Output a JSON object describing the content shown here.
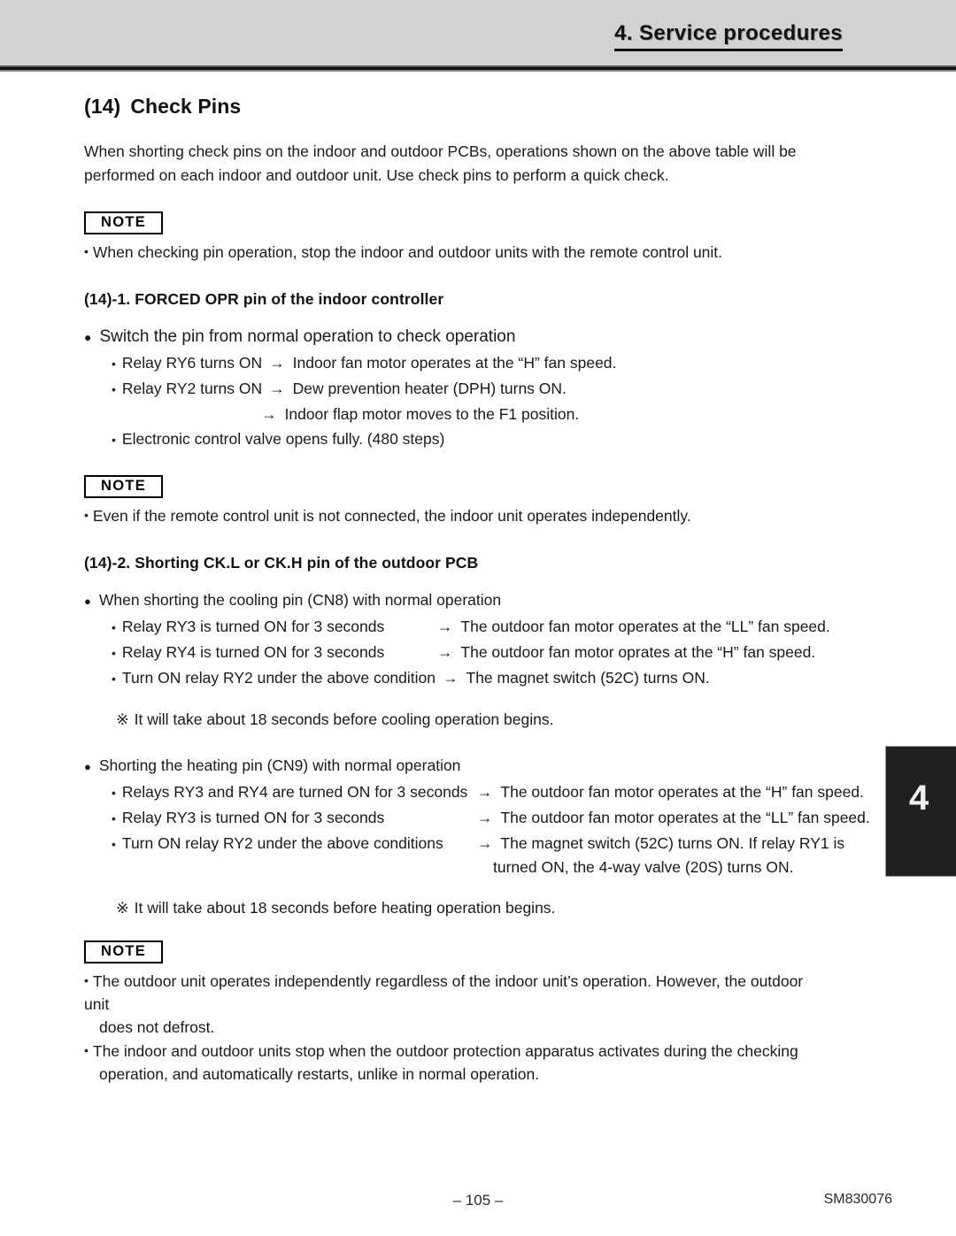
{
  "header": {
    "chapter_title": "4. Service procedures"
  },
  "chapter_tab": {
    "number": "4"
  },
  "section": {
    "number": "(14)",
    "title": "Check Pins",
    "intro": "When shorting check pins on the indoor and outdoor PCBs, operations shown on the above table will be performed on each indoor and outdoor unit. Use check pins to perform a quick check."
  },
  "note1": {
    "badge": "NOTE",
    "bullet": "•",
    "line1": "When checking pin operation, stop the indoor and outdoor units with the remote control unit."
  },
  "subsection1": {
    "heading": "(14)-1. FORCED OPR pin of the indoor controller",
    "group": {
      "disc": "●",
      "head": "Switch the pin from normal operation to check operation",
      "items": [
        {
          "dot": "•",
          "lead": "Relay RY6 turns ON",
          "arrow": "→",
          "tail": "Indoor fan motor operates at the “H” fan speed."
        },
        {
          "dot": "•",
          "lead": "Relay RY2 turns ON",
          "arrow": "→",
          "tail": "Dew prevention heater (DPH) turns ON."
        },
        {
          "dot": "",
          "lead": "",
          "arrow": "→",
          "tail": "Indoor flap motor moves to the F1 position."
        },
        {
          "dot": "•",
          "lead": "Electronic control valve opens fully. (480 steps)",
          "arrow": "",
          "tail": ""
        }
      ]
    }
  },
  "note2": {
    "badge": "NOTE",
    "bullet": "•",
    "line1": "Even if the remote control unit is not connected, the indoor unit operates independently."
  },
  "subsection2": {
    "heading": "(14)-2. Shorting CK.L or CK.H pin of the outdoor PCB",
    "cooling": {
      "disc": "●",
      "head": "When shorting the cooling pin (CN8) with normal operation",
      "items": [
        {
          "dot": "•",
          "lead": "Relay RY3 is turned ON for 3 seconds",
          "arrow": "→",
          "tail": "The outdoor fan motor operates at the “LL” fan speed."
        },
        {
          "dot": "•",
          "lead": "Relay RY4 is turned ON for 3 seconds",
          "arrow": "→",
          "tail": "The outdoor fan motor oprates at the “H” fan speed."
        },
        {
          "dot": "•",
          "lead": "Turn ON relay RY2 under the above condition",
          "arrow": "→",
          "tail": "The magnet switch (52C) turns ON."
        }
      ],
      "star": "※",
      "star_text": "It will take about 18 seconds before cooling operation begins."
    },
    "heating": {
      "disc": "●",
      "head": "Shorting the heating pin (CN9) with normal operation",
      "items": [
        {
          "dot": "•",
          "lead": "Relays RY3 and RY4 are turned ON for 3 seconds",
          "arrow": "→",
          "tail": "The outdoor fan motor operates at the “H” fan speed."
        },
        {
          "dot": "•",
          "lead": "Relay RY3 is turned ON for 3 seconds",
          "arrow": "→",
          "tail": "The outdoor fan motor operates at the “LL” fan speed."
        },
        {
          "dot": "•",
          "lead": "Turn ON relay RY2 under the above conditions",
          "arrow": "→",
          "tail": "The magnet switch (52C) turns ON. If relay RY1 is"
        }
      ],
      "continuation": "turned ON, the 4-way valve (20S) turns ON.",
      "star": "※",
      "star_text": "It will take about 18 seconds before heating operation begins."
    }
  },
  "note3": {
    "badge": "NOTE",
    "bullet": "•",
    "line1": "The outdoor unit operates independently regardless of the indoor unit’s operation. However, the outdoor unit",
    "line1_cont": "does not defrost.",
    "line2": "The indoor and outdoor units stop when the outdoor protection apparatus activates during the checking",
    "line2_cont": "operation, and automatically restarts, unlike in normal operation."
  },
  "footer": {
    "page_number": "– 105 –",
    "document_code": "SM830076"
  }
}
